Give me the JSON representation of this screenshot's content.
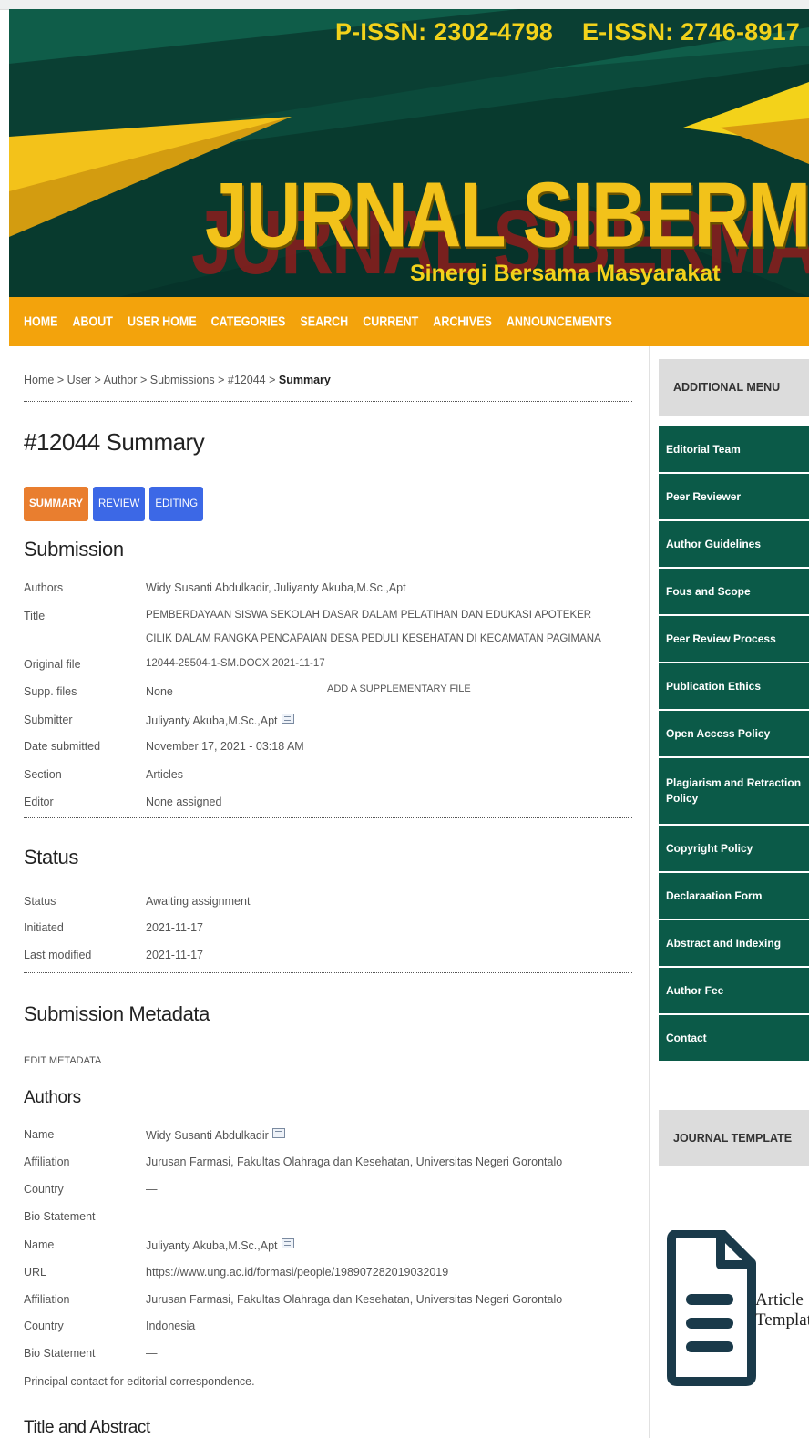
{
  "header": {
    "p_issn": "P-ISSN: 2302-4798",
    "e_issn": "E-ISSN: 2746-8917",
    "journal_title": "JURNAL SIBERMAS",
    "tagline": "Sinergi Bersama Masyarakat"
  },
  "nav": [
    "HOME",
    "ABOUT",
    "USER HOME",
    "CATEGORIES",
    "SEARCH",
    "CURRENT",
    "ARCHIVES",
    "ANNOUNCEMENTS"
  ],
  "breadcrumb": {
    "items": [
      "Home",
      "User",
      "Author",
      "Submissions",
      "#12044"
    ],
    "separator": ">",
    "current": "Summary"
  },
  "page_title": "#12044 Summary",
  "tabs": [
    "SUMMARY",
    "REVIEW",
    "EDITING"
  ],
  "submission": {
    "heading": "Submission",
    "rows": [
      {
        "label": "Authors",
        "value": "Widy Susanti Abdulkadir, Juliyanty Akuba,M.Sc.,Apt"
      },
      {
        "label": "Title",
        "value": "PEMBERDAYAAN SISWA SEKOLAH DASAR DALAM PELATIHAN DAN EDUKASI APOTEKER CILIK DALAM RANGKA PENCAPAIAN DESA PEDULI KESEHATAN DI KECAMATAN PAGIMANA"
      },
      {
        "label": "Original file",
        "value": "12044-25504-1-SM.DOCX  2021-11-17"
      },
      {
        "label": "Supp. files",
        "value": "None"
      },
      {
        "label": "Submitter",
        "value": "Juliyanty Akuba,M.Sc.,Apt"
      },
      {
        "label": "Date submitted",
        "value": "November 17, 2021 - 03:18 AM"
      },
      {
        "label": "Section",
        "value": "Articles"
      },
      {
        "label": "Editor",
        "value": "None assigned"
      }
    ],
    "add_supp_label": "ADD A SUPPLEMENTARY FILE"
  },
  "status": {
    "heading": "Status",
    "rows": [
      {
        "label": "Status",
        "value": "Awaiting assignment"
      },
      {
        "label": "Initiated",
        "value": "2021-11-17"
      },
      {
        "label": "Last modified",
        "value": "2021-11-17"
      }
    ]
  },
  "metadata": {
    "heading": "Submission Metadata",
    "edit_label": "EDIT METADATA",
    "authors_heading": "Authors",
    "authors": [
      {
        "name_label": "Name",
        "name": "Widy Susanti Abdulkadir",
        "affiliation_label": "Affiliation",
        "affiliation": "Jurusan Farmasi, Fakultas Olahraga dan Kesehatan, Universitas Negeri Gorontalo",
        "country_label": "Country",
        "country": "—",
        "bio_label": "Bio Statement",
        "bio": "—"
      },
      {
        "name_label": "Name",
        "name": "Juliyanty Akuba,M.Sc.,Apt",
        "url_label": "URL",
        "url": "https://www.ung.ac.id/formasi/people/198907282019032019",
        "affiliation_label": "Affiliation",
        "affiliation": "Jurusan Farmasi, Fakultas Olahraga dan Kesehatan, Universitas Negeri Gorontalo",
        "country_label": "Country",
        "country": "Indonesia",
        "bio_label": "Bio Statement",
        "bio": "—"
      }
    ],
    "principal_contact_note": "Principal contact for editorial correspondence.",
    "title_abstract_heading": "Title and Abstract"
  },
  "sidebar": {
    "additional_menu_heading": "ADDITIONAL MENU",
    "menu_items": [
      "Editorial Team",
      "Peer Reviewer",
      "Author Guidelines",
      "Fous and Scope",
      "Peer Review Process",
      "Publication Ethics",
      "Open Access Policy",
      "Plagiarism and Retraction Policy",
      "Copyright Policy",
      "Declaraation Form",
      "Abstract and Indexing",
      "Author Fee",
      "Contact"
    ],
    "journal_template_heading": "JOURNAL TEMPLATE",
    "template_icon_line1": "Article",
    "template_icon_line2": "Template"
  },
  "colors": {
    "banner_green": "#0b4a3b",
    "nav_orange": "#f3a30c",
    "title_gold": "#f2c21a",
    "sidebar_green": "#0b5a48",
    "tab_summary": "#e97e2f",
    "tab_blue": "#3c68e6"
  }
}
